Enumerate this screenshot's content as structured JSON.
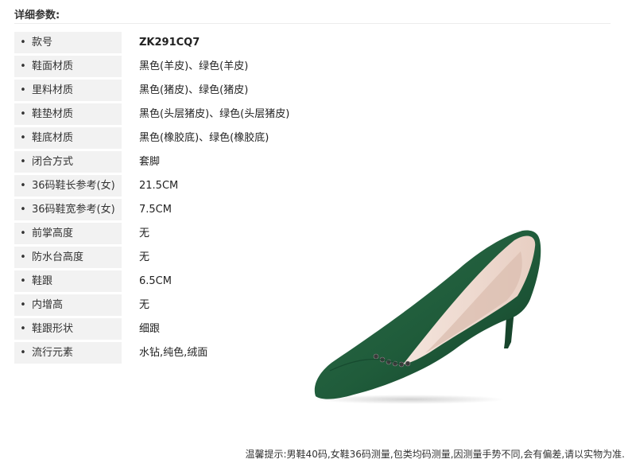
{
  "header": {
    "title": "详细参数:"
  },
  "specs": [
    {
      "label": "款号",
      "value": "ZK291CQ7"
    },
    {
      "label": "鞋面材质",
      "value": "黑色(羊皮)、绿色(羊皮)"
    },
    {
      "label": "里料材质",
      "value": "黑色(猪皮)、绿色(猪皮)"
    },
    {
      "label": "鞋垫材质",
      "value": "黑色(头层猪皮)、绿色(头层猪皮)"
    },
    {
      "label": "鞋底材质",
      "value": "黑色(橡胶底)、绿色(橡胶底)"
    },
    {
      "label": "闭合方式",
      "value": "套脚"
    },
    {
      "label": "36码鞋长参考(女)",
      "value": "21.5CM"
    },
    {
      "label": "36码鞋宽参考(女)",
      "value": "7.5CM"
    },
    {
      "label": "前掌高度",
      "value": "无"
    },
    {
      "label": "防水台高度",
      "value": "无"
    },
    {
      "label": "鞋跟",
      "value": "6.5CM"
    },
    {
      "label": "内增高",
      "value": "无"
    },
    {
      "label": "鞋跟形状",
      "value": "细跟"
    },
    {
      "label": "流行元素",
      "value": "水钻,纯色,绒面"
    }
  ],
  "bullet": "•",
  "product_image": {
    "name": "green-suede-pointed-pump",
    "color": "#1f5b3a"
  },
  "footer": {
    "note": "温馨提示:男鞋40码,女鞋36码测量,包类均码测量,因测量手势不同,会有偏差,请以实物为准."
  }
}
